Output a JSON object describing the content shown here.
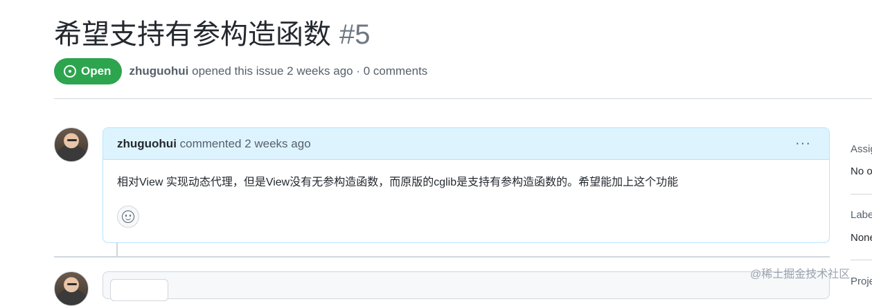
{
  "issue": {
    "title": "希望支持有参构造函数",
    "number": "#5",
    "state": "Open",
    "author": "zhuguohui",
    "meta": "opened this issue 2 weeks ago · 0 comments"
  },
  "comment": {
    "author": "zhuguohui",
    "action": "commented 2 weeks ago",
    "body": "相对View 实现动态代理，但是View没有无参构造函数，而原版的cglib是支持有参构造函数的。希望能加上这个功能",
    "menu": "···"
  },
  "sidebar": {
    "assignees_label": "Assig",
    "assignees_value": "No o",
    "labels_label": "Labe",
    "labels_value": "None",
    "projects_label": "Proje"
  },
  "watermark": "@稀土掘金技术社区",
  "colors": {
    "open_green": "#2da44e",
    "header_blue": "#ddf4ff",
    "border_blue": "#b6e3ff"
  }
}
